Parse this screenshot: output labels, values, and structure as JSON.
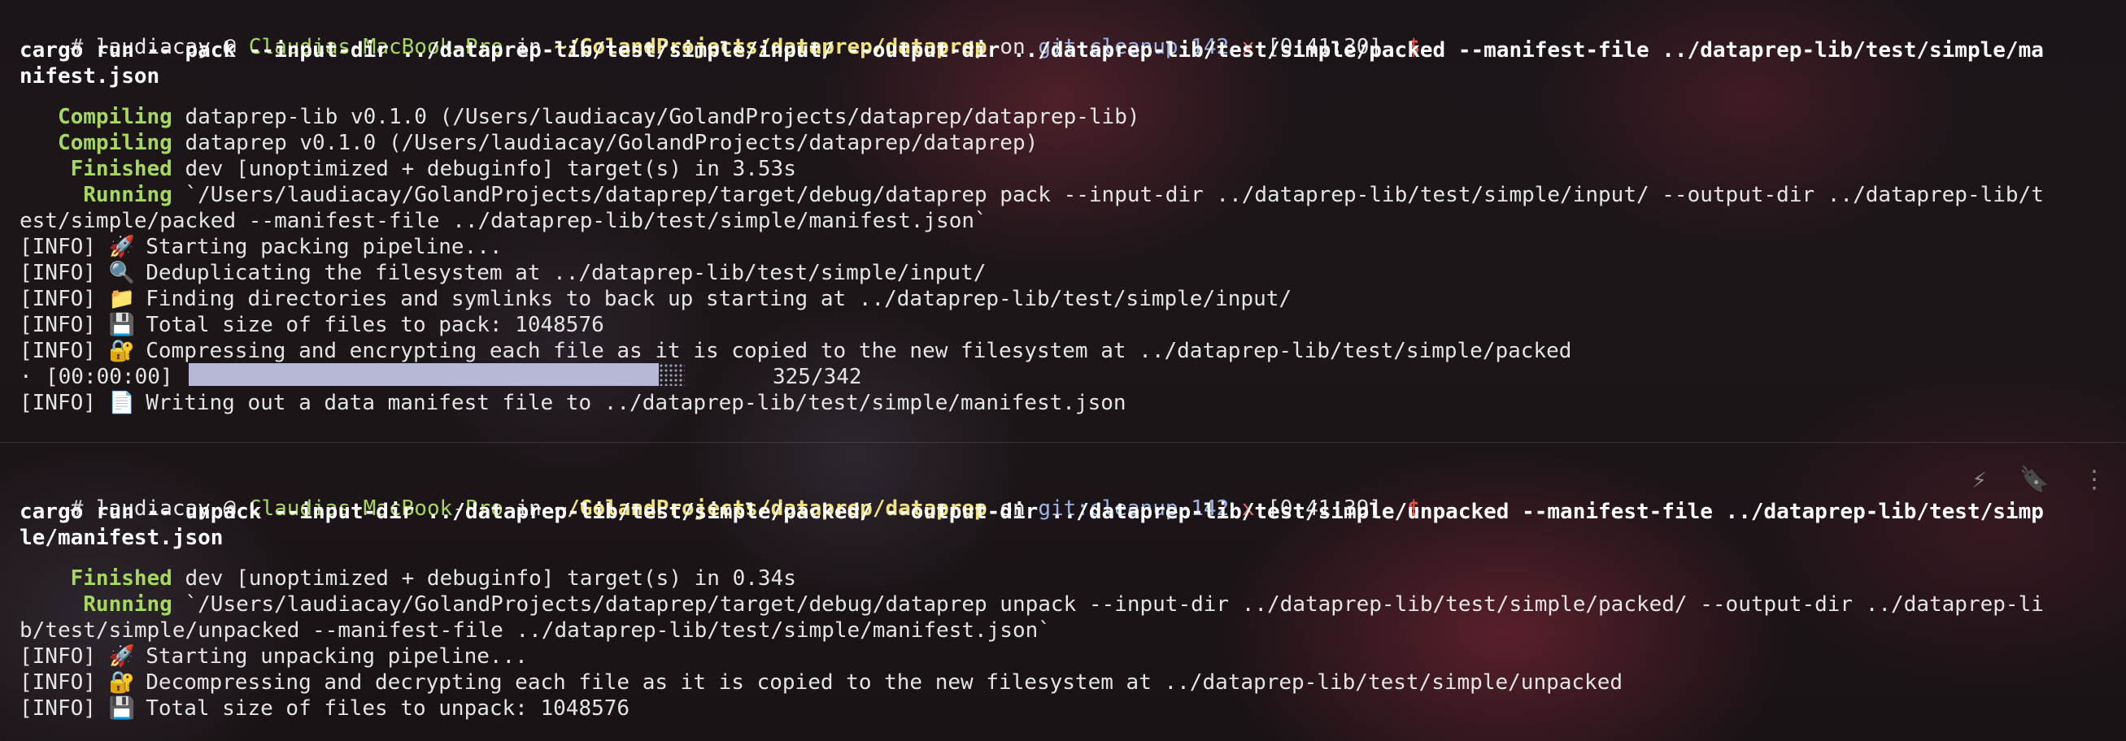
{
  "block1": {
    "prompt": {
      "hash": "#",
      "user": "laudiacay",
      "at": "@",
      "host": "Claudias-MacBook-Pro",
      "in": "in",
      "dir": "~/GolandProjects/dataprep/dataprep",
      "on": "on",
      "git_label": "git:",
      "branch": "cleanup-142",
      "dirty": "x",
      "time": "[0:41:30]",
      "dollar": "$"
    },
    "command": [
      "cargo run -- pack --input-dir ../dataprep-lib/test/simple/input/ --output-dir ../dataprep-lib/test/simple/packed --manifest-file ../dataprep-lib/test/simple/ma",
      "nifest.json"
    ],
    "output": [
      {
        "kind": "status",
        "status": "   Compiling",
        "text": " dataprep-lib v0.1.0 (/Users/laudiacay/GolandProjects/dataprep/dataprep-lib)"
      },
      {
        "kind": "status",
        "status": "   Compiling",
        "text": " dataprep v0.1.0 (/Users/laudiacay/GolandProjects/dataprep/dataprep)"
      },
      {
        "kind": "status",
        "status": "    Finished",
        "text": " dev [unoptimized + debuginfo] target(s) in 3.53s"
      },
      {
        "kind": "status",
        "status": "     Running",
        "text": " `/Users/laudiacay/GolandProjects/dataprep/target/debug/dataprep pack --input-dir ../dataprep-lib/test/simple/input/ --output-dir ../dataprep-lib/t"
      },
      {
        "kind": "plain",
        "text": "est/simple/packed --manifest-file ../dataprep-lib/test/simple/manifest.json`"
      },
      {
        "kind": "info",
        "prefix": "[INFO] ",
        "emoji": "🚀",
        "text": " Starting packing pipeline..."
      },
      {
        "kind": "info",
        "prefix": "[INFO] ",
        "emoji": "🔍",
        "text": " Deduplicating the filesystem at ../dataprep-lib/test/simple/input/"
      },
      {
        "kind": "info",
        "prefix": "[INFO] ",
        "emoji": "📁",
        "text": " Finding directories and symlinks to back up starting at ../dataprep-lib/test/simple/input/"
      },
      {
        "kind": "info",
        "prefix": "[INFO] ",
        "emoji": "💾",
        "text": " Total size of files to pack: 1048576"
      },
      {
        "kind": "info",
        "prefix": "[INFO] ",
        "emoji": "🔐",
        "text": " Compressing and encrypting each file as it is copied to the new filesystem at ../dataprep-lib/test/simple/packed"
      }
    ],
    "progress": {
      "spinner": "·",
      "elapsed": "[00:00:00]",
      "count": "325/342",
      "done": 325,
      "total": 342
    },
    "after_progress": {
      "prefix": "[INFO] ",
      "emoji": "📄",
      "text": " Writing out a data manifest file to ../dataprep-lib/test/simple/manifest.json"
    }
  },
  "block2": {
    "prompt": {
      "hash": "#",
      "user": "laudiacay",
      "at": "@",
      "host": "Claudias-MacBook-Pro",
      "in": "in",
      "dir": "~/GolandProjects/dataprep/dataprep",
      "on": "on",
      "git_label": "git:",
      "branch": "cleanup-142",
      "dirty": "x",
      "time": "[0:41:39]",
      "dollar": "$"
    },
    "command": [
      "cargo run -- unpack --input-dir ../dataprep-lib/test/simple/packed/ --output-dir ../dataprep-lib/test/simple/unpacked --manifest-file ../dataprep-lib/test/simp",
      "le/manifest.json"
    ],
    "output": [
      {
        "kind": "status",
        "status": "    Finished",
        "text": " dev [unoptimized + debuginfo] target(s) in 0.34s"
      },
      {
        "kind": "status",
        "status": "     Running",
        "text": " `/Users/laudiacay/GolandProjects/dataprep/target/debug/dataprep unpack --input-dir ../dataprep-lib/test/simple/packed/ --output-dir ../dataprep-li"
      },
      {
        "kind": "plain",
        "text": "b/test/simple/unpacked --manifest-file ../dataprep-lib/test/simple/manifest.json`"
      },
      {
        "kind": "info",
        "prefix": "[INFO] ",
        "emoji": "🚀",
        "text": " Starting unpacking pipeline..."
      },
      {
        "kind": "info",
        "prefix": "[INFO] ",
        "emoji": "🔐",
        "text": " Decompressing and decrypting each file as it is copied to the new filesystem at ../dataprep-lib/test/simple/unpacked"
      },
      {
        "kind": "info",
        "prefix": "[INFO] ",
        "emoji": "💾",
        "text": " Total size of files to unpack: 1048576"
      }
    ],
    "actions": {
      "ai_icon": "⚡",
      "bookmark_icon": "🔖",
      "more_icon": "⋮"
    }
  }
}
